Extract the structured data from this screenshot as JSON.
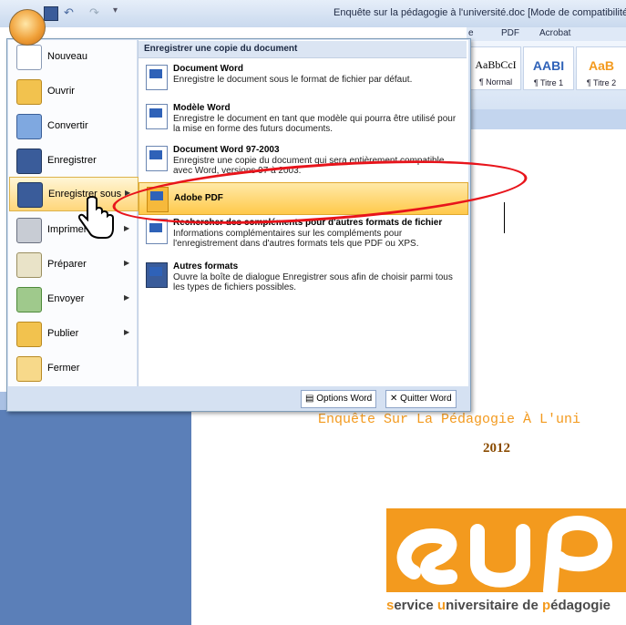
{
  "window": {
    "title": "Enquête sur la pédagogie à l'université.doc [Mode de compatibilité] - I"
  },
  "ribbon": {
    "tabs": [
      "e",
      "PDF",
      "Acrobat"
    ],
    "styles": [
      {
        "sample": "AaBbCcI",
        "name": "¶ Normal"
      },
      {
        "sample": "AABI",
        "name": "¶ Titre 1"
      },
      {
        "sample": "AaB",
        "name": "¶ Titre 2"
      }
    ]
  },
  "office_menu": {
    "items": [
      {
        "label": "Nouveau",
        "icon": "new-document-icon"
      },
      {
        "label": "Ouvrir",
        "icon": "open-folder-icon"
      },
      {
        "label": "Convertir",
        "icon": "convert-icon"
      },
      {
        "label": "Enregistrer",
        "icon": "save-icon"
      },
      {
        "label": "Enregistrer sous",
        "icon": "save-as-icon"
      },
      {
        "label": "Imprimer",
        "icon": "print-icon"
      },
      {
        "label": "Préparer",
        "icon": "prepare-icon"
      },
      {
        "label": "Envoyer",
        "icon": "send-icon"
      },
      {
        "label": "Publier",
        "icon": "publish-icon"
      },
      {
        "label": "Fermer",
        "icon": "close-folder-icon"
      }
    ],
    "submenu_header": "Enregistrer une copie du document",
    "submenu_items": [
      {
        "title": "Document Word",
        "desc": "Enregistre le document sous le format de fichier par défaut."
      },
      {
        "title": "Modèle Word",
        "desc": "Enregistre le document en tant que modèle qui pourra être utilisé pour la mise en forme des futurs documents."
      },
      {
        "title": "Document Word 97-2003",
        "desc": "Enregistre une copie du document qui sera entièrement compatible avec Word, versions 97 à 2003."
      },
      {
        "title": "Adobe PDF",
        "desc": ""
      },
      {
        "title": "Rechercher des compléments pour d'autres formats de fichier",
        "desc": "Informations complémentaires sur les compléments pour l'enregistrement dans d'autres formats tels que PDF ou XPS."
      },
      {
        "title": "Autres formats",
        "desc": "Ouvre la boîte de dialogue Enregistrer sous afin de choisir parmi tous les types de fichiers possibles."
      }
    ],
    "footer": {
      "options_label": "Options Word",
      "quit_label": "Quitter Word"
    }
  },
  "document": {
    "title": "Enquête Sur La Pédagogie À L'uni",
    "year": "2012",
    "logo_text_parts": [
      "s",
      "ervice ",
      "u",
      "niversitaire de ",
      "p",
      "édagogie"
    ]
  },
  "colors": {
    "accent_orange": "#f39a1e",
    "highlight_red": "#e8141b",
    "menu_highlight": "#ffc94a"
  }
}
